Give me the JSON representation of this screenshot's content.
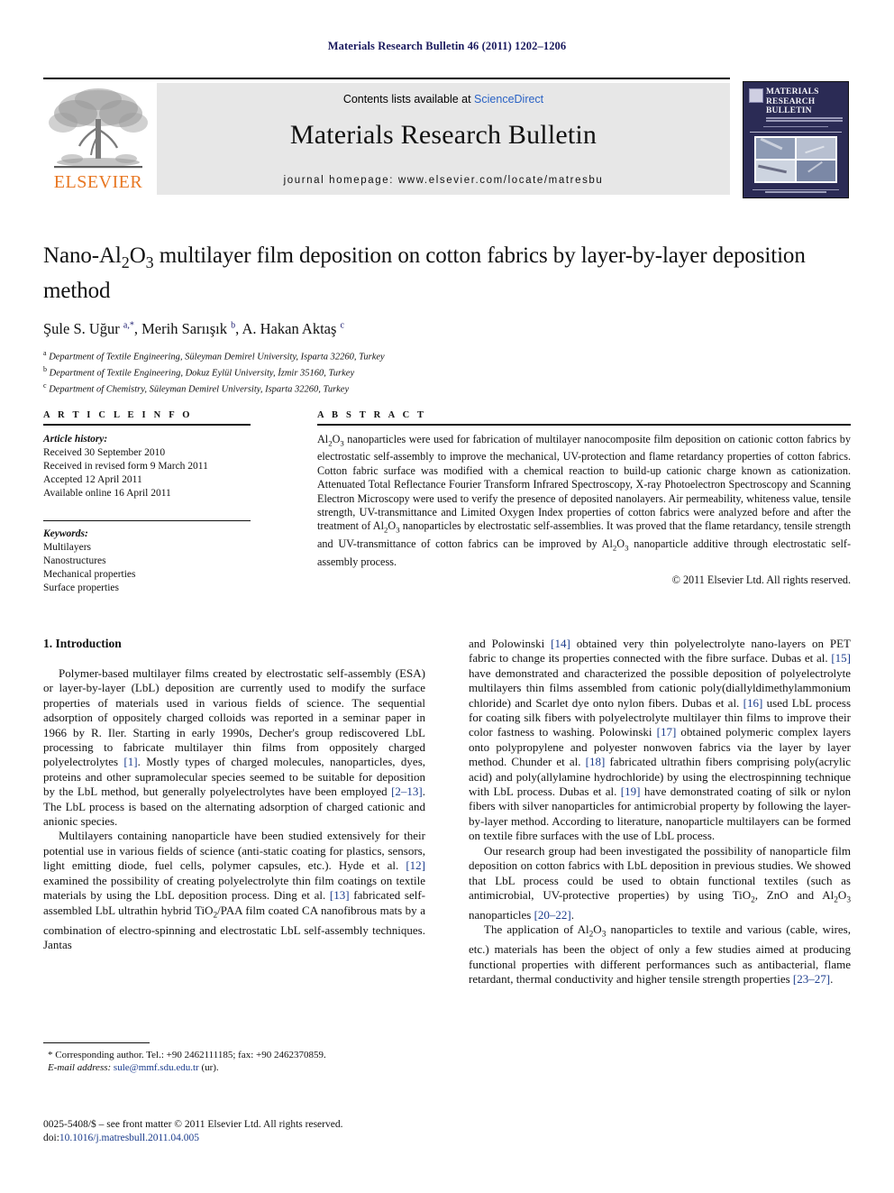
{
  "running_head": "Materials Research Bulletin 46 (2011) 1202–1206",
  "masthead": {
    "publisher": "ELSEVIER",
    "contents_prefix": "Contents lists available at ",
    "contents_link": "ScienceDirect",
    "journal_title": "Materials Research Bulletin",
    "homepage": "journal homepage: www.elsevier.com/locate/matresbu",
    "cover": {
      "line1": "MATERIALS",
      "line2": "RESEARCH",
      "line3": "BULLETIN"
    }
  },
  "article": {
    "title": "Nano-Al2O3 multilayer film deposition on cotton fabrics by layer-by-layer deposition method",
    "title_html": "Nano-Al<sub>2</sub>O<sub>3</sub> multilayer film deposition on cotton fabrics by layer-by-layer deposition method",
    "authors_html": "Şule S. Uğur <sup>a,*</sup>, Merih Sarıışık <sup>b</sup>, A. Hakan Aktaş <sup>c</sup>",
    "affiliations": [
      "a Department of Textile Engineering, Süleyman Demirel University, Isparta 32260, Turkey",
      "b Department of Textile Engineering, Dokuz Eylül University, İzmir 35160, Turkey",
      "c Department of Chemistry, Süleyman Demirel University, Isparta 32260, Turkey"
    ],
    "affiliations_html": [
      "<sup>a</sup> Department of Textile Engineering, Süleyman Demirel University, Isparta 32260, Turkey",
      "<sup>b</sup> Department of Textile Engineering, Dokuz Eylül University, İzmir 35160, Turkey",
      "<sup>c</sup> Department of Chemistry, Süleyman Demirel University, Isparta 32260, Turkey"
    ]
  },
  "article_info": {
    "heading": "A R T I C L E   I N F O",
    "history_label": "Article history:",
    "history": [
      "Received 30 September 2010",
      "Received in revised form 9 March 2011",
      "Accepted 12 April 2011",
      "Available online 16 April 2011"
    ],
    "keywords_label": "Keywords:",
    "keywords": [
      "Multilayers",
      "Nanostructures",
      "Mechanical properties",
      "Surface properties"
    ]
  },
  "abstract": {
    "heading": "A B S T R A C T",
    "text_html": "Al<sub>2</sub>O<sub>3</sub> nanoparticles were used for fabrication of multilayer nanocomposite film deposition on cationic cotton fabrics by electrostatic self-assembly to improve the mechanical, UV-protection and flame retardancy properties of cotton fabrics. Cotton fabric surface was modified with a chemical reaction to build-up cationic charge known as cationization. Attenuated Total Reflectance Fourier Transform Infrared Spectroscopy, X-ray Photoelectron Spectroscopy and Scanning Electron Microscopy were used to verify the presence of deposited nanolayers. Air permeability, whiteness value, tensile strength, UV-transmittance and Limited Oxygen Index properties of cotton fabrics were analyzed before and after the treatment of Al<sub>2</sub>O<sub>3</sub> nanoparticles by electrostatic self-assemblies. It was proved that the flame retardancy, tensile strength and UV-transmittance of cotton fabrics can be improved by Al<sub>2</sub>O<sub>3</sub> nanoparticle additive through electrostatic self-assembly process.",
    "copyright": "© 2011 Elsevier Ltd. All rights reserved."
  },
  "body": {
    "section_heading": "1. Introduction",
    "left_paragraphs_html": [
      "Polymer-based multilayer films created by electrostatic self-assembly (ESA) or layer-by-layer (LbL) deposition are currently used to modify the surface properties of materials used in various fields of science. The sequential adsorption of oppositely charged colloids was reported in a seminar paper in 1966 by R. Iler. Starting in early 1990s, Decher's group rediscovered LbL processing to fabricate multilayer thin films from oppositely charged polyelectrolytes <span class=\"cit\">[1]</span>. Mostly types of charged molecules, nanoparticles, dyes, proteins and other supramolecular species seemed to be suitable for deposition by the LbL method, but generally polyelectrolytes have been employed <span class=\"cit\">[2–13]</span>. The LbL process is based on the alternating adsorption of charged cationic and anionic species.",
      "Multilayers containing nanoparticle have been studied extensively for their potential use in various fields of science (anti-static coating for plastics, sensors, light emitting diode, fuel cells, polymer capsules, etc.). Hyde et al. <span class=\"cit\">[12]</span> examined the possibility of creating polyelectrolyte thin film coatings on textile materials by using the LbL deposition process. Ding et al. <span class=\"cit\">[13]</span> fabricated self-assembled LbL ultrathin hybrid TiO<sub>2</sub>/PAA film coated CA nanofibrous mats by a combination of electro-spinning and electrostatic LbL self-assembly techniques. Jantas"
    ],
    "right_paragraphs_html": [
      "and Polowinski <span class=\"cit\">[14]</span> obtained very thin polyelectrolyte nano-layers on PET fabric to change its properties connected with the fibre surface. Dubas et al. <span class=\"cit\">[15]</span> have demonstrated and characterized the possible deposition of polyelectrolyte multilayers thin films assembled from cationic poly(diallyldimethylammonium chloride) and Scarlet dye onto nylon fibers. Dubas et al. <span class=\"cit\">[16]</span> used LbL process for coating silk fibers with polyelectrolyte multilayer thin films to improve their color fastness to washing. Polowinski <span class=\"cit\">[17]</span> obtained polymeric complex layers onto polypropylene and polyester nonwoven fabrics via the layer by layer method. Chunder et al. <span class=\"cit\">[18]</span> fabricated ultrathin fibers comprising poly(acrylic acid) and poly(allylamine hydrochloride) by using the electrospinning technique with LbL process. Dubas et al. <span class=\"cit\">[19]</span> have demonstrated coating of silk or nylon fibers with silver nanoparticles for antimicrobial property by following the layer-by-layer method. According to literature, nanoparticle multilayers can be formed on textile fibre surfaces with the use of LbL process.",
      "Our research group had been investigated the possibility of nanoparticle film deposition on cotton fabrics with LbL deposition in previous studies. We showed that LbL process could be used to obtain functional textiles (such as antimicrobial, UV-protective properties) by using TiO<sub>2</sub>, ZnO and Al<sub>2</sub>O<sub>3</sub> nanoparticles <span class=\"cit\">[20–22]</span>.",
      "The application of Al<sub>2</sub>O<sub>3</sub> nanoparticles to textile and various (cable, wires, etc.) materials has been the object of only a few studies aimed at producing functional properties with different performances such as antibacterial, flame retardant, thermal conductivity and higher tensile strength properties <span class=\"cit\">[23–27]</span>."
    ]
  },
  "footnote": {
    "corresponding_html": "* Corresponding author. Tel.: +90 2462111185; fax: +90 2462370859.",
    "email_label": "E-mail address:",
    "email": "sule@mmf.sdu.edu.tr",
    "email_suffix": "(ur)."
  },
  "colophon": {
    "line1": "0025-5408/$ – see front matter © 2011 Elsevier Ltd. All rights reserved.",
    "doi_label": "doi:",
    "doi": "10.1016/j.matresbull.2011.04.005"
  },
  "colors": {
    "running_head": "#1a1a5e",
    "link": "#2a62c4",
    "citation": "#1b3c8c",
    "elsevier_orange": "#e87722",
    "band_gray": "#e7e7e7",
    "cover_navy": "#2b2b55"
  }
}
